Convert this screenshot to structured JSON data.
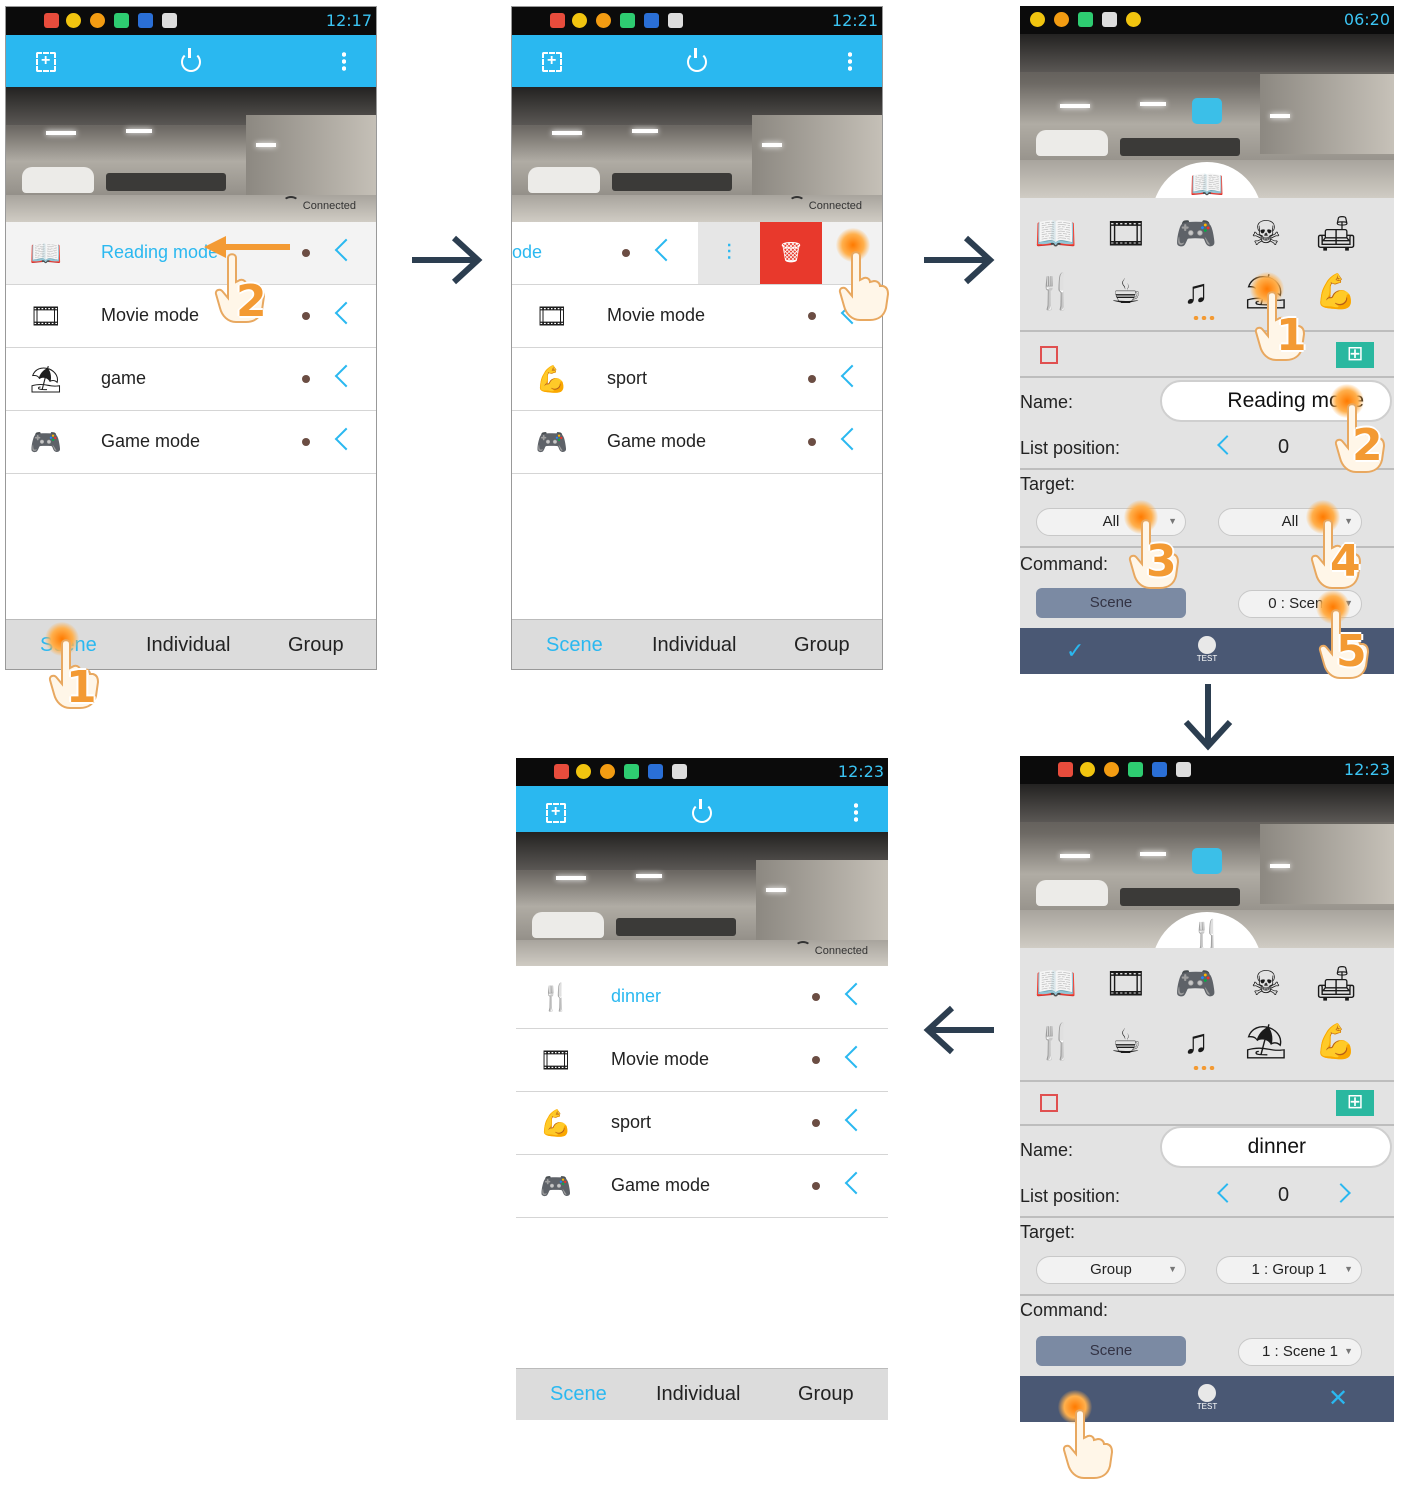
{
  "screens": {
    "s1": {
      "time": "12:17",
      "connected": "Connected",
      "rows": [
        {
          "label": "Reading mode",
          "icon": "book-icon"
        },
        {
          "label": "Movie mode",
          "icon": "film-reel-icon"
        },
        {
          "label": "game",
          "icon": "reclining-person-icon"
        },
        {
          "label": "Game mode",
          "icon": "gamepad-icon"
        }
      ],
      "tabs": [
        "Scene",
        "Individual",
        "Group"
      ]
    },
    "s2": {
      "time": "12:21",
      "connected": "Connected",
      "rows": [
        {
          "label": "ode",
          "icon": "book-icon"
        },
        {
          "label": "Movie mode",
          "icon": "film-reel-icon"
        },
        {
          "label": "sport",
          "icon": "flexed-arm-icon"
        },
        {
          "label": "Game mode",
          "icon": "gamepad-icon"
        }
      ],
      "tabs": [
        "Scene",
        "Individual",
        "Group"
      ]
    },
    "s3": {
      "time": "06:20",
      "form": {
        "name_label": "Name:",
        "name_value": "Reading mode",
        "list_position_label": "List position:",
        "list_position_value": "0",
        "target_label": "Target:",
        "target_a": "All",
        "target_b": "All",
        "command_label": "Command:",
        "command_btn": "Scene",
        "command_sel": "0 : Scene"
      },
      "test_label": "TEST"
    },
    "s4": {
      "time": "12:23",
      "form": {
        "name_label": "Name:",
        "name_value": "dinner",
        "list_position_label": "List position:",
        "list_position_value": "0",
        "target_label": "Target:",
        "target_a": "Group",
        "target_b": "1 : Group 1",
        "command_label": "Command:",
        "command_btn": "Scene",
        "command_sel": "1 : Scene 1"
      },
      "test_label": "TEST"
    },
    "s5": {
      "time": "12:23",
      "connected": "Connected",
      "rows": [
        {
          "label": "dinner",
          "icon": "fork-knife-icon"
        },
        {
          "label": "Movie mode",
          "icon": "film-reel-icon"
        },
        {
          "label": "sport",
          "icon": "flexed-arm-icon"
        },
        {
          "label": "Game mode",
          "icon": "gamepad-icon"
        }
      ],
      "tabs": [
        "Scene",
        "Individual",
        "Group"
      ]
    }
  },
  "step_numbers": {
    "s1": [
      "1",
      "2"
    ],
    "s3": [
      "1",
      "2",
      "3",
      "4",
      "5"
    ]
  },
  "icon_grid": [
    "book-icon",
    "film-reel-icon",
    "gamepad-icon",
    "skull-icon",
    "sofa-icon",
    "fork-knife-icon",
    "coffee-cup-icon",
    "music-note-icon",
    "reclining-person-icon",
    "flexed-arm-icon"
  ],
  "colors": {
    "accent": "#2ab8f0",
    "delete": "#e8392c",
    "bottom_bar": "#4a5874",
    "step": "#f39a33",
    "arrow": "#2c3e50"
  }
}
